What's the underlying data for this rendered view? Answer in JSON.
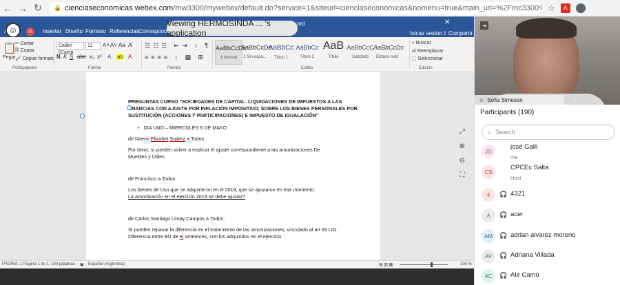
{
  "browser": {
    "url_host": "cienciaseconomicas.webex.com",
    "url_path": "/mw3300/mywebex/default.do?service=1&siteurl=cienciaseconomicas&nomenu=true&main_url=%2Fmc3300%2Fe.do%3Fsiteurl%3D..."
  },
  "word": {
    "tabs": [
      "Ar",
      "Insertar",
      "Diseño",
      "Formato",
      "Referencias",
      "Corresponden"
    ],
    "doc_app": "ord",
    "signin": "Iniciar sesión",
    "share": "Compartir",
    "rec_count": "0"
  },
  "viewing": {
    "text": "Viewing HERMOSINDA ... 's application"
  },
  "ribbon": {
    "paste": "Pegar",
    "cut": "Cortar",
    "copy": "Copiar",
    "format_painter": "Copiar formato",
    "clipboard_label": "Portapapeles",
    "font_name": "Calibri (Cuerp",
    "font_size": "11",
    "font_label": "Fuente",
    "paragraph_label": "Párrafo",
    "styles_label": "Estilos",
    "edit_label": "Edición",
    "find": "Buscar",
    "replace": "Reemplazar",
    "select": "Seleccionar",
    "styles": [
      {
        "sample": "AaBbCcDc",
        "name": "1 Normal"
      },
      {
        "sample": "AaBbCcDc",
        "name": "1 Sin espa..."
      },
      {
        "sample": "AaBbCc",
        "name": "Título 1"
      },
      {
        "sample": "AaBbCc",
        "name": "Título 2"
      },
      {
        "sample": "AaB",
        "name": "Título"
      },
      {
        "sample": "AaBbCcC",
        "name": "Subtítulo"
      },
      {
        "sample": "AaBbCcDc",
        "name": "Énfasis sutil"
      }
    ]
  },
  "document": {
    "title_line1": "PREGUNTAS CURSO \"SOCIEDADES DE CAPITAL. LIQUIDACIONES DE IMPUESTOS A LAS",
    "title_line2": "ANANCIAS CON AJUSTE POR INFLACIÓN IMPOSITIVO, SOBRE LOS BIENES PERSONALES POR",
    "title_line3": "SUSTITUCIÓN (ACCIONES Y PARTICIPACIONES) E IMPUESTO DE IGUALACIÓN\"",
    "bullet": "DIA UNO – MIERCOLES 6 DE MAYO",
    "from1_pre": "de Noemi ",
    "from1_name1": "Elizabet",
    "from1_name2": "Suárez",
    "from1_post": " a Todos:",
    "msg1_l1": "Por favor, si pueden volver a explicar el ajuste correspondiente a las amortizaciones De",
    "msg1_l2": "Muebles y Útiles",
    "from2": "de Francisco a Todos:",
    "msg2_l1": "Los bienes de Uso que se adquirieron en el 2018, que se ajustaron en ese momento.",
    "msg2_l2": "La amortización en el ejercicio 2019 se debe ajustar?",
    "from3": "de Carlos Santiago Limay Campos a Todos:",
    "msg3_l1": "Si pueden repasar la diferencia en el tratamiento de las amortizaciones, vinculado al art 93 LIG.",
    "msg3_l2_pre": "Diferencia entre BU de ",
    "msg3_l2_ej": "ej",
    "msg3_l2_post": " anteriores, con los adquiridos  en el ejercicio"
  },
  "status": {
    "page": "PÁGINA: 1",
    "page_of": "Página 1 de 1",
    "words": "180 palabras",
    "lang": "Español (Argentina)",
    "zoom": "100 %"
  },
  "panel": {
    "video_name": "Sofia Simesen",
    "participants_title": "Participants (190)",
    "search_placeholder": "Search",
    "participants": [
      {
        "initials": "JG",
        "name": "josé Galli",
        "sub": "me",
        "bg": "#f5e6ef",
        "fg": "#a3477a",
        "mic": false
      },
      {
        "initials": "CS",
        "name": "CPCEc Salta",
        "sub": "Host",
        "bg": "#fbe4e1",
        "fg": "#c54a3a",
        "mic": false
      },
      {
        "initials": "4",
        "name": "4321",
        "sub": "",
        "bg": "#fbe4e1",
        "fg": "#c54a3a",
        "mic": true
      },
      {
        "initials": "A",
        "name": "acer",
        "sub": "",
        "bg": "#ececec",
        "fg": "#666",
        "mic": true
      },
      {
        "initials": "AM",
        "name": "adrian alvarez moreno",
        "sub": "",
        "bg": "#e1eef8",
        "fg": "#2c6fa6",
        "mic": true
      },
      {
        "initials": "AV",
        "name": "Adriana Villada",
        "sub": "",
        "bg": "#ececec",
        "fg": "#666",
        "mic": true
      },
      {
        "initials": "AC",
        "name": "Ale Camú",
        "sub": "",
        "bg": "#e1f4ec",
        "fg": "#2b8a5e",
        "mic": true
      }
    ]
  }
}
